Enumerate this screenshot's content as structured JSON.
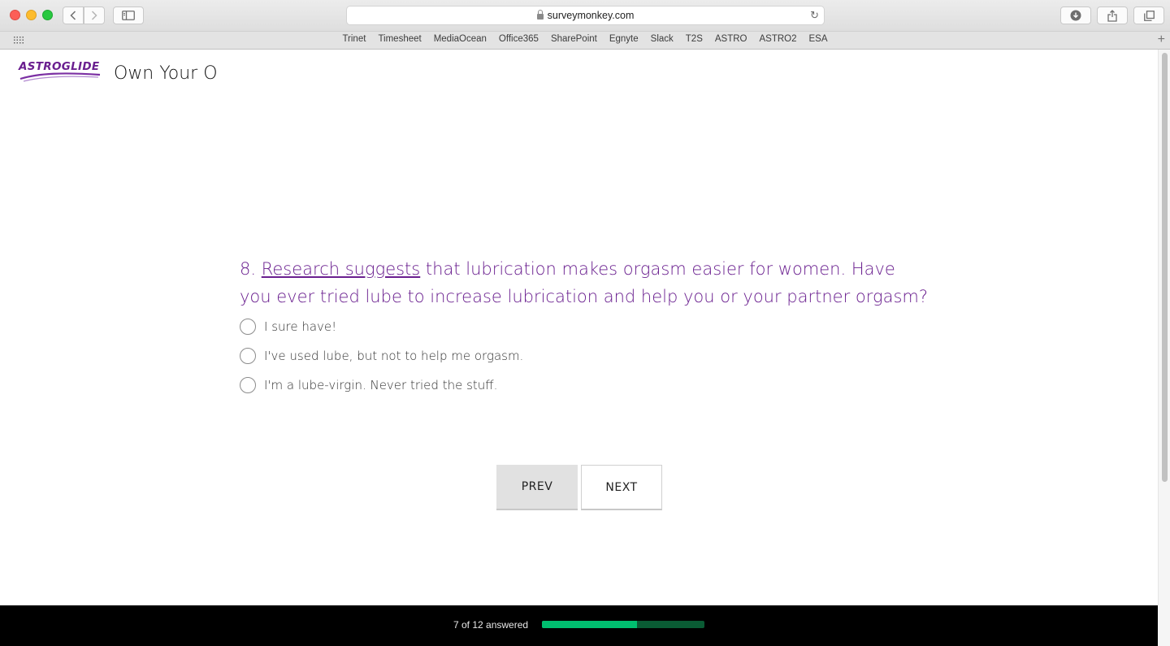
{
  "browser": {
    "url": "surveymonkey.com",
    "bookmarks": [
      "Trinet",
      "Timesheet",
      "MediaOcean",
      "Office365",
      "SharePoint",
      "Egnyte",
      "Slack",
      "T2S",
      "ASTRO",
      "ASTRO2",
      "ESA"
    ]
  },
  "header": {
    "logo_text": "ASTROGLIDE",
    "survey_title": "Own Your O"
  },
  "question": {
    "number": "8.",
    "link_text": "Research suggests",
    "text": " that lubrication makes orgasm easier for women. Have you ever tried lube to increase lubrication and help you or your partner orgasm?",
    "options": [
      "I sure have!",
      "I've used lube, but not to help me orgasm.",
      "I'm a lube-virgin. Never tried the stuff."
    ]
  },
  "buttons": {
    "prev": "PREV",
    "next": "NEXT"
  },
  "progress": {
    "label": "7 of 12 answered",
    "answered": 7,
    "total": 12,
    "fill_color": "#00bf6f",
    "track_color": "#0a5b34"
  },
  "colors": {
    "brand_purple": "#6a1f8f"
  }
}
